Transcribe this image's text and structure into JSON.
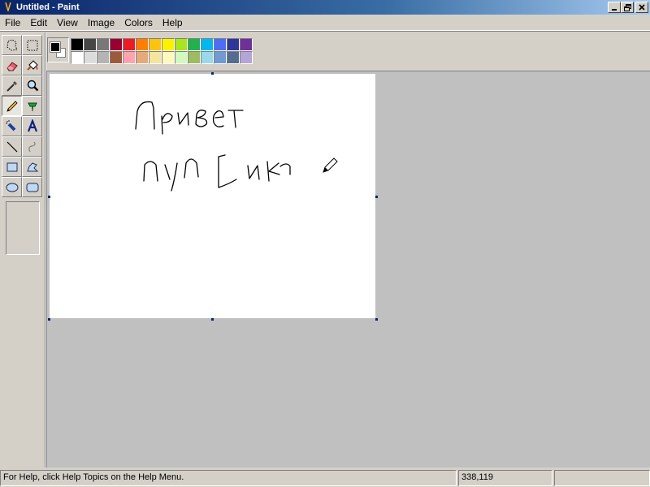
{
  "window": {
    "title": "Untitled - Paint"
  },
  "menu": [
    "File",
    "Edit",
    "View",
    "Image",
    "Colors",
    "Help"
  ],
  "tools": [
    {
      "name": "free-form-select-icon",
      "active": false
    },
    {
      "name": "select-icon",
      "active": false
    },
    {
      "name": "eraser-icon",
      "active": false
    },
    {
      "name": "fill-with-color-icon",
      "active": false
    },
    {
      "name": "pick-color-icon",
      "active": false
    },
    {
      "name": "magnifier-icon",
      "active": false
    },
    {
      "name": "pencil-icon",
      "active": true
    },
    {
      "name": "brush-icon",
      "active": false
    },
    {
      "name": "airbrush-icon",
      "active": false
    },
    {
      "name": "text-icon",
      "active": false
    },
    {
      "name": "line-icon",
      "active": false
    },
    {
      "name": "curve-icon",
      "active": false
    },
    {
      "name": "rectangle-icon",
      "active": false
    },
    {
      "name": "polygon-icon",
      "active": false
    },
    {
      "name": "ellipse-icon",
      "active": false
    },
    {
      "name": "rounded-rectangle-icon",
      "active": false
    }
  ],
  "palette": {
    "foreground": "#000000",
    "background": "#ffffff",
    "row1": [
      "#000000",
      "#464646",
      "#787878",
      "#990030",
      "#ed1c24",
      "#ff7e00",
      "#ffc20e",
      "#fff200",
      "#a8e61d",
      "#22b14c",
      "#00b7ef",
      "#4d6df3",
      "#2f3699",
      "#6f3198"
    ],
    "row2": [
      "#ffffff",
      "#dcdcdc",
      "#b4b4b4",
      "#9c5a3c",
      "#ffa3b1",
      "#e5aa7a",
      "#f5e49c",
      "#fff9bd",
      "#d3f9bc",
      "#9dbb61",
      "#99d9ea",
      "#709ad1",
      "#546d8e",
      "#b5a5d5"
    ]
  },
  "status": {
    "help_text": "For Help, click Help Topics on the Help Menu.",
    "coordinates": "338,119",
    "size": ""
  }
}
